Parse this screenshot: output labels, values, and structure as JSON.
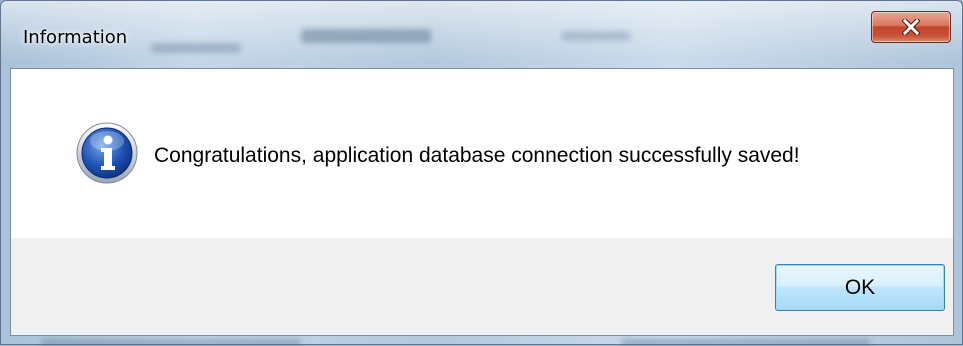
{
  "window": {
    "title": "Information",
    "close_icon": "close-icon"
  },
  "dialog": {
    "icon": "info-icon",
    "message": "Congratulations, application database connection successfully saved!"
  },
  "buttons": {
    "ok_label": "OK"
  },
  "colors": {
    "close_button": "#c4462a",
    "ok_button_border": "#3c7fb1",
    "info_icon_blue": "#1c4fa8"
  }
}
